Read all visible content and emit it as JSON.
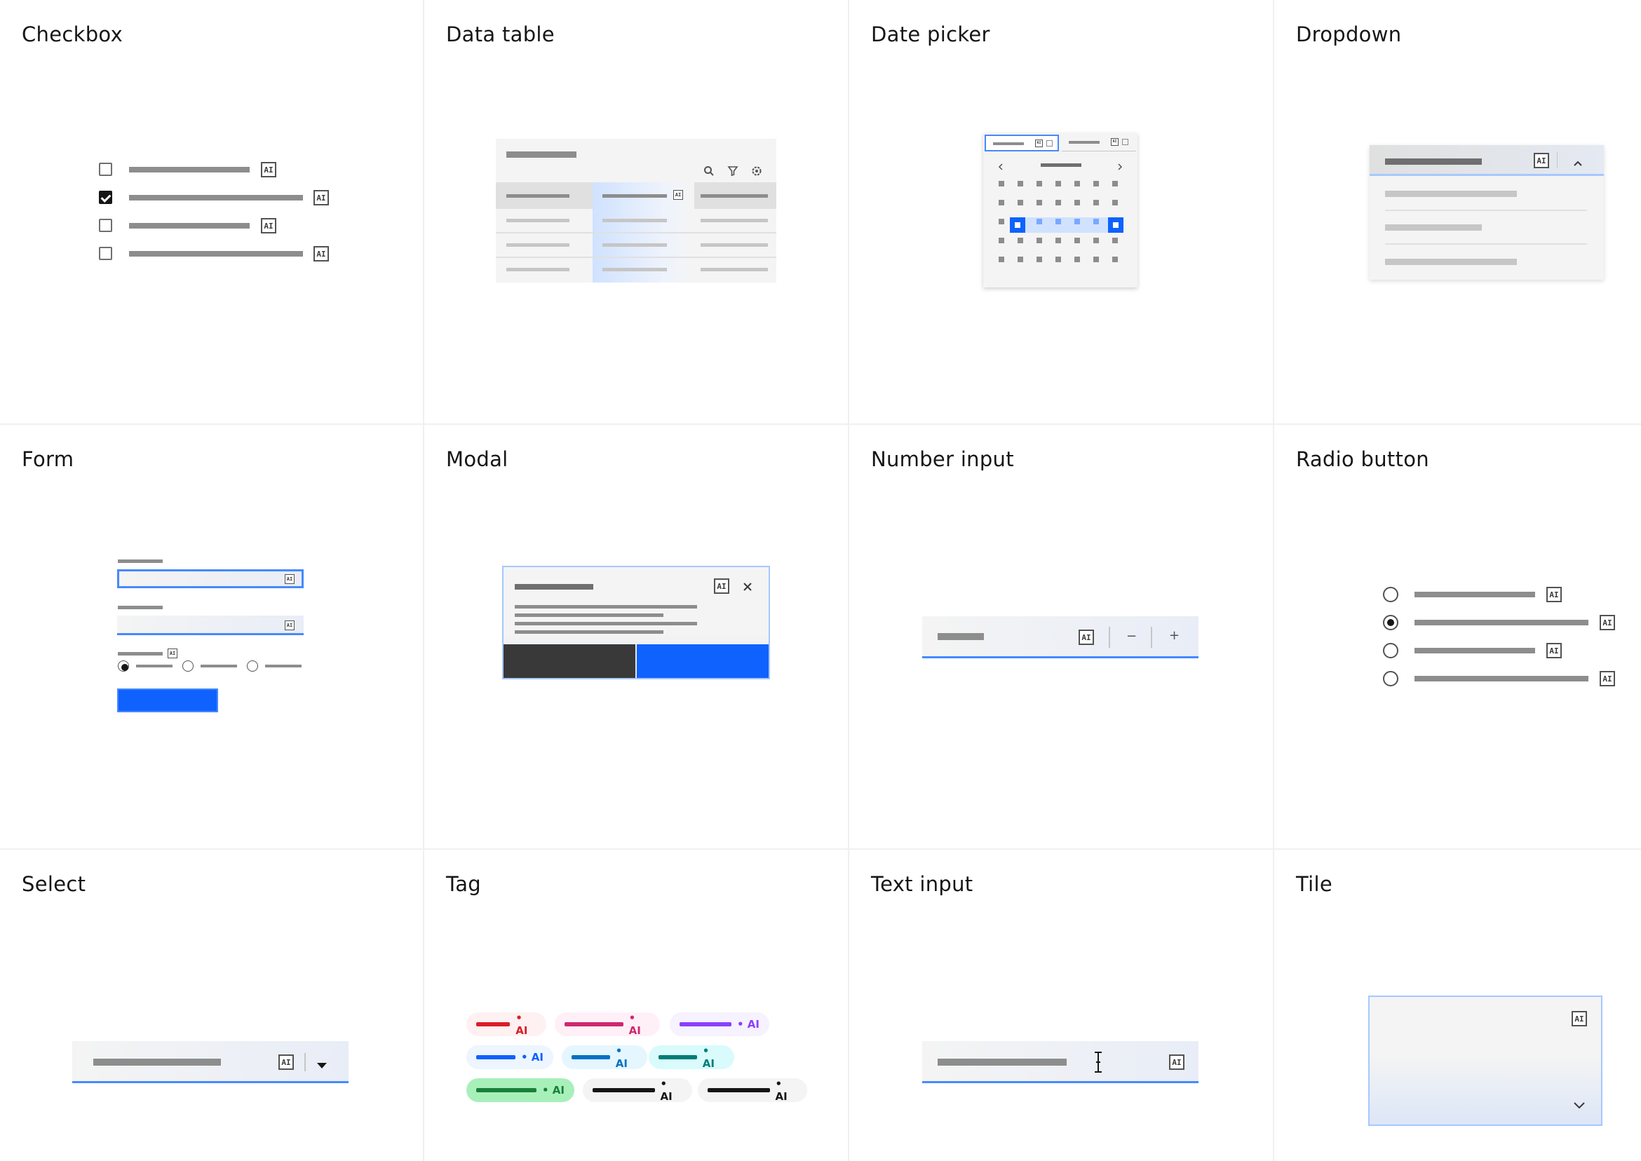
{
  "cells": [
    {
      "title": "Checkbox"
    },
    {
      "title": "Data table"
    },
    {
      "title": "Date picker"
    },
    {
      "title": "Dropdown"
    },
    {
      "title": "Form"
    },
    {
      "title": "Modal"
    },
    {
      "title": "Number input"
    },
    {
      "title": "Radio button"
    },
    {
      "title": "Select"
    },
    {
      "title": "Tag"
    },
    {
      "title": "Text input"
    },
    {
      "title": "Tile"
    }
  ],
  "ai_label": "AI",
  "tag_suffix": "• AI",
  "number_input": {
    "minus": "−",
    "plus": "+"
  },
  "checkbox_states": [
    false,
    true,
    false,
    false
  ],
  "radio_states": [
    false,
    true,
    false,
    false
  ],
  "colors": {
    "accent": "#0f62fe",
    "tag_red": "#da1e28",
    "tag_magenta": "#d02670",
    "tag_purple": "#8a3ffc",
    "tag_blue": "#0f62fe",
    "tag_cyan": "#0072c3",
    "tag_teal": "#007d79",
    "tag_green": "#198038",
    "tag_gray": "#161616"
  },
  "icons": {
    "search": "search-icon",
    "filter": "filter-icon",
    "settings": "gear-icon",
    "close": "close-icon",
    "chevron_down": "chevron-down-icon",
    "chevron_up": "chevron-up-icon",
    "caret_down": "caret-down-icon",
    "text_cursor": "text-cursor-icon"
  }
}
